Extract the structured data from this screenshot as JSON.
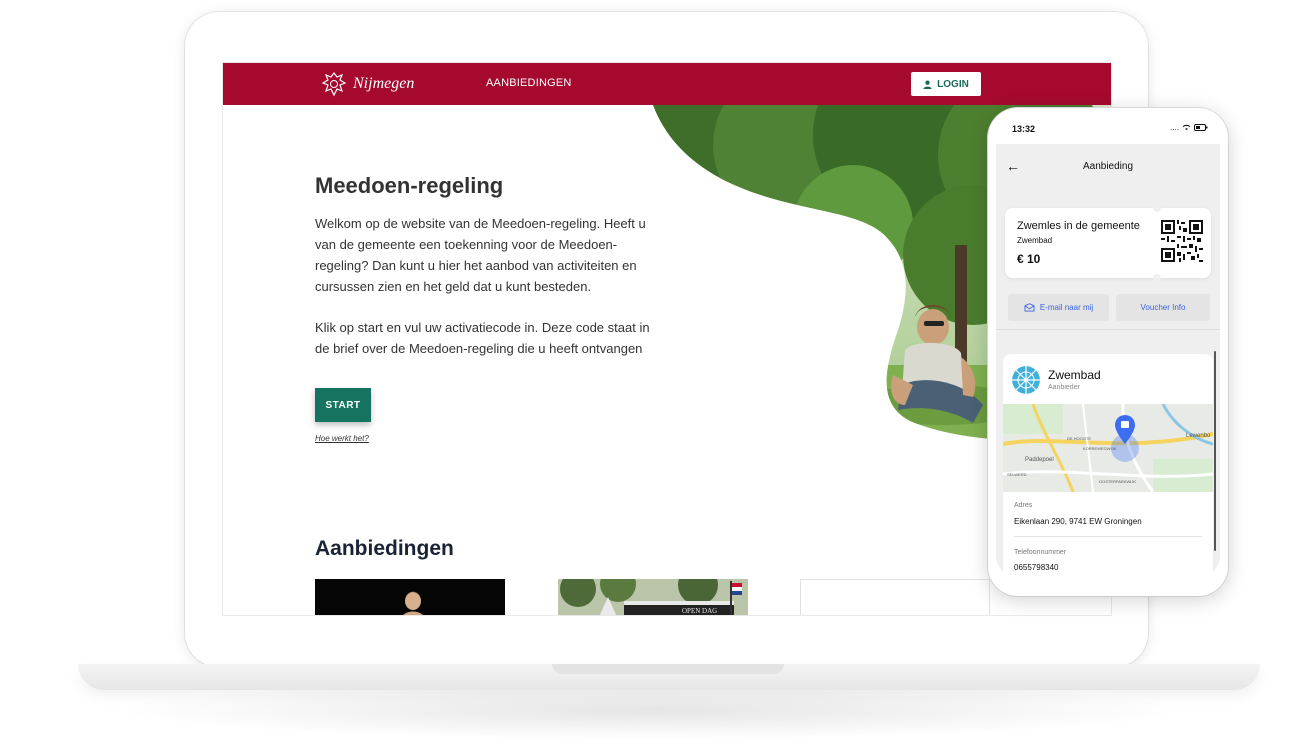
{
  "website": {
    "nav": {
      "brand": "Nijmegen",
      "link": "AANBIEDINGEN",
      "login": "LOGIN"
    },
    "hero": {
      "title": "Meedoen-regeling",
      "paragraph1": "Welkom op de website van de Meedoen-regeling. Heeft u van de gemeente een toekenning voor de Meedoen-regeling? Dan kunt u hier het aanbod van activiteiten en cursussen zien en het geld dat u kunt besteden.",
      "paragraph2": "Klik op start en vul uw activatiecode in. Deze code staat in de brief over de Meedoen-regeling die u heeft ontvangen",
      "start": "START",
      "help": "Hoe werkt het?"
    },
    "offers": {
      "title": "Aanbiedingen",
      "card2_banner": "OPEN DAG"
    }
  },
  "phone": {
    "status_time": "13:32",
    "title": "Aanbieding",
    "voucher": {
      "title": "Zwemles in de gemeente",
      "subtitle": "Zwembad",
      "price": "€ 10"
    },
    "actions": {
      "email": "E-mail naar mij",
      "info": "Voucher Info"
    },
    "provider": {
      "name": "Zwembad",
      "role": "Aanbieder",
      "address_label": "Adres",
      "address": "Eikenlaan 290, 9741 EW Groningen",
      "phone_label": "Telefoonnummer",
      "phone": "0655798340"
    },
    "map_labels": {
      "paddepoel": "Paddepoel",
      "lewenborg": "Lewenbo",
      "de_hoogte": "DE HOOGTE",
      "korrewegwijk": "KORREWEGWIJK",
      "oosterparkwijk": "OOSTERPARKWIJK",
      "selwerd": "SELWERD"
    }
  },
  "colors": {
    "brand_red": "#a50a2e",
    "primary_green": "#15735f",
    "link_blue": "#3b63e0"
  }
}
